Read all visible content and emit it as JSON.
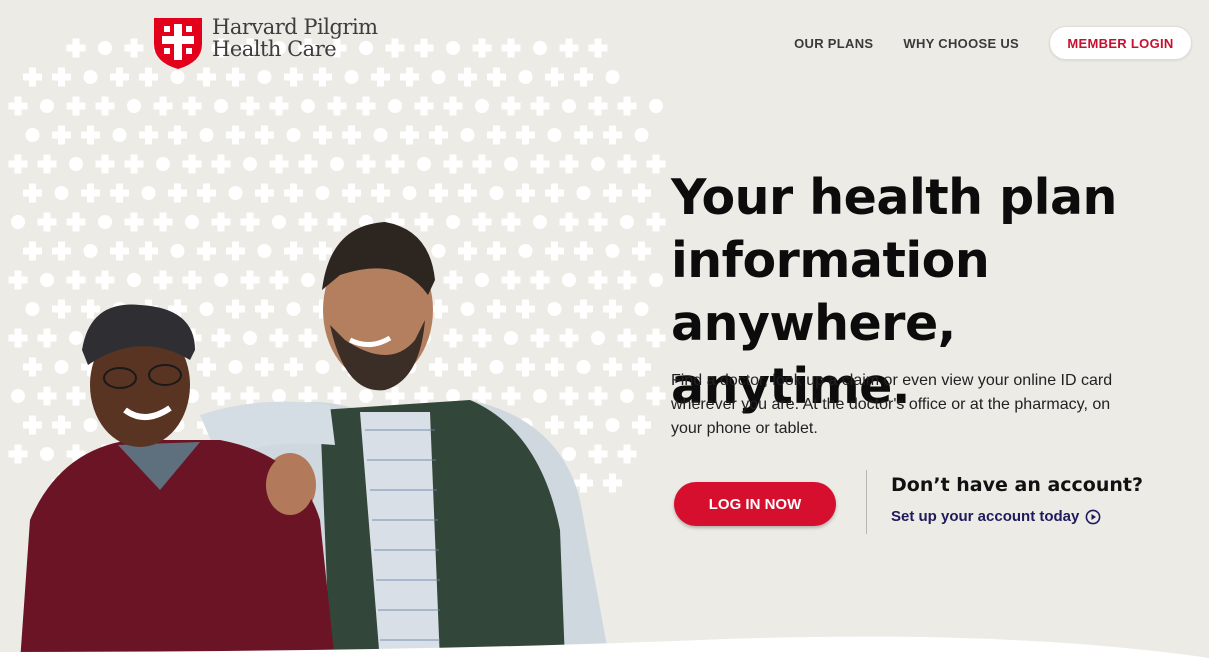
{
  "brand": {
    "name_line1": "Harvard Pilgrim",
    "name_line2": "Health Care",
    "logo_color": "#e3001b"
  },
  "nav": {
    "links": [
      "OUR PLANS",
      "WHY CHOOSE US"
    ],
    "login_label": "MEMBER LOGIN"
  },
  "hero": {
    "title": "Your health plan information anywhere, anytime.",
    "body": "Find a doctor, look up a claim or even view your online ID card wherever you are. At the doctor's office or at the pharmacy, on your phone or tablet.",
    "login_button": "LOG IN NOW",
    "no_account": "Don’t have an account?",
    "setup_link": "Set up your account today"
  },
  "colors": {
    "accent": "#d50f2d",
    "link": "#1f1a5c",
    "background": "#ecebe6"
  },
  "icons": [
    "harvard-pilgrim-shield-icon",
    "play-circle-icon"
  ]
}
